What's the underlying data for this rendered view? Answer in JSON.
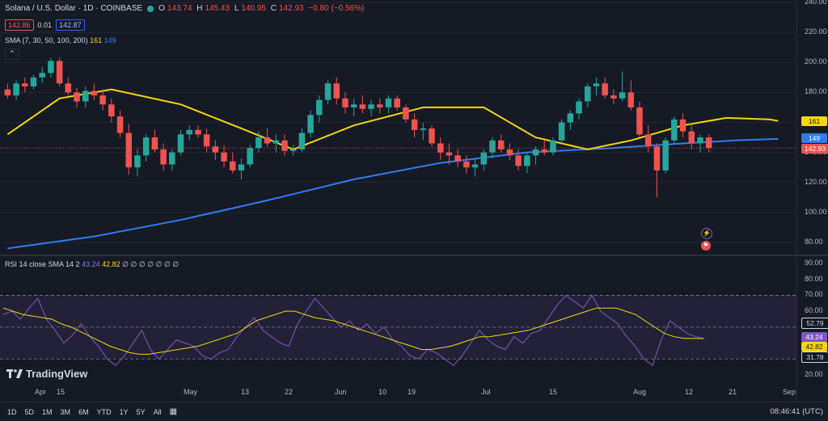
{
  "header": {
    "symbol": "Solana / U.S. Dollar · 1D · COINBASE",
    "ohlc": {
      "o_label": "O",
      "o": "143.74",
      "h_label": "H",
      "h": "145.43",
      "l_label": "L",
      "l": "140.95",
      "c_label": "C",
      "c": "142.93",
      "chg": "−0.80 (−0.56%)"
    },
    "bid": "142.86",
    "spread": "0.01",
    "ask": "142.87"
  },
  "indicators": {
    "sma_label": "SMA (7, 30, 50, 100, 200)",
    "sma_v1": "161",
    "sma_v2": "149",
    "rsi_label": "RSI 14 close SMA 14 2",
    "rsi_v": "43.24",
    "rsi_sma": "42.82",
    "rsi_tail": "∅ ∅ ∅ ∅ ∅ ∅ ∅"
  },
  "price_axis": [
    "240.00",
    "220.00",
    "200.00",
    "180.00",
    "160.00",
    "140.00",
    "120.00",
    "100.00",
    "80.00"
  ],
  "price_labels": {
    "sma_yellow": "161",
    "sma_blue": "149",
    "last": "142.93"
  },
  "rsi_axis": [
    "90.00",
    "80.00",
    "70.00",
    "60.00",
    "50.00",
    "40.00",
    "30.00",
    "20.00"
  ],
  "rsi_labels": {
    "a": "52.79",
    "b": "43.24",
    "c": "42.82",
    "d": "31.78"
  },
  "time_axis": [
    "Apr",
    "15",
    "May",
    "13",
    "22",
    "Jun",
    "10",
    "19",
    "Jul",
    "15",
    "Aug",
    "12",
    "21",
    "Sep"
  ],
  "timeframes": [
    "1D",
    "5D",
    "1M",
    "3M",
    "6M",
    "YTD",
    "1Y",
    "5Y",
    "All"
  ],
  "clock": "08:46:41 (UTC)",
  "logo": "TradingView",
  "colors": {
    "up": "#26a69a",
    "down": "#ef5350",
    "sma_yellow": "#f5d60b",
    "sma_blue": "#2d7cf2",
    "rsi": "#7e57c2",
    "bg": "#161a25"
  },
  "chart_data": {
    "type": "candlestick",
    "ylim": [
      70,
      240
    ],
    "rsi_ylim": [
      20,
      90
    ],
    "rsi_bands": [
      30,
      70
    ],
    "candles": [
      [
        182,
        186,
        176,
        178
      ],
      [
        178,
        188,
        175,
        186
      ],
      [
        186,
        190,
        180,
        184
      ],
      [
        184,
        192,
        182,
        190
      ],
      [
        190,
        197,
        186,
        193
      ],
      [
        193,
        203,
        190,
        201
      ],
      [
        201,
        203,
        184,
        186
      ],
      [
        186,
        190,
        178,
        180
      ],
      [
        180,
        183,
        170,
        174
      ],
      [
        174,
        184,
        170,
        181
      ],
      [
        181,
        186,
        175,
        178
      ],
      [
        178,
        182,
        168,
        172
      ],
      [
        172,
        176,
        160,
        164
      ],
      [
        164,
        168,
        150,
        153
      ],
      [
        153,
        159,
        125,
        130
      ],
      [
        130,
        142,
        124,
        138
      ],
      [
        138,
        152,
        134,
        150
      ],
      [
        150,
        155,
        140,
        142
      ],
      [
        142,
        146,
        128,
        132
      ],
      [
        132,
        142,
        128,
        140
      ],
      [
        140,
        155,
        138,
        152
      ],
      [
        152,
        158,
        148,
        155
      ],
      [
        155,
        158,
        150,
        152
      ],
      [
        152,
        156,
        140,
        144
      ],
      [
        144,
        148,
        135,
        140
      ],
      [
        140,
        145,
        130,
        134
      ],
      [
        134,
        140,
        126,
        128
      ],
      [
        128,
        136,
        122,
        132
      ],
      [
        132,
        145,
        130,
        143
      ],
      [
        143,
        154,
        140,
        150
      ],
      [
        150,
        156,
        144,
        146
      ],
      [
        146,
        152,
        140,
        148
      ],
      [
        148,
        152,
        138,
        141
      ],
      [
        141,
        145,
        138,
        142
      ],
      [
        142,
        156,
        140,
        153
      ],
      [
        153,
        168,
        150,
        165
      ],
      [
        165,
        178,
        160,
        175
      ],
      [
        175,
        188,
        172,
        186
      ],
      [
        186,
        190,
        172,
        176
      ],
      [
        176,
        180,
        166,
        170
      ],
      [
        170,
        176,
        164,
        172
      ],
      [
        172,
        178,
        166,
        169
      ],
      [
        169,
        175,
        164,
        172
      ],
      [
        172,
        176,
        166,
        170
      ],
      [
        170,
        178,
        166,
        176
      ],
      [
        176,
        178,
        168,
        170
      ],
      [
        170,
        172,
        160,
        162
      ],
      [
        162,
        166,
        150,
        155
      ],
      [
        155,
        160,
        148,
        156
      ],
      [
        156,
        158,
        144,
        146
      ],
      [
        146,
        150,
        135,
        140
      ],
      [
        140,
        146,
        132,
        138
      ],
      [
        138,
        142,
        130,
        134
      ],
      [
        134,
        138,
        126,
        130
      ],
      [
        130,
        136,
        124,
        132
      ],
      [
        132,
        142,
        128,
        140
      ],
      [
        140,
        150,
        136,
        148
      ],
      [
        148,
        152,
        140,
        142
      ],
      [
        142,
        146,
        135,
        138
      ],
      [
        138,
        142,
        128,
        131
      ],
      [
        131,
        140,
        126,
        138
      ],
      [
        138,
        144,
        132,
        142
      ],
      [
        142,
        148,
        138,
        140
      ],
      [
        140,
        150,
        138,
        148
      ],
      [
        148,
        162,
        146,
        160
      ],
      [
        160,
        168,
        155,
        166
      ],
      [
        166,
        176,
        162,
        174
      ],
      [
        174,
        186,
        170,
        184
      ],
      [
        184,
        190,
        178,
        186
      ],
      [
        186,
        190,
        176,
        178
      ],
      [
        178,
        182,
        172,
        176
      ],
      [
        176,
        194,
        174,
        180
      ],
      [
        180,
        188,
        168,
        170
      ],
      [
        170,
        174,
        150,
        152
      ],
      [
        152,
        158,
        140,
        144
      ],
      [
        144,
        146,
        110,
        128
      ],
      [
        128,
        150,
        126,
        148
      ],
      [
        148,
        164,
        146,
        162
      ],
      [
        162,
        166,
        150,
        154
      ],
      [
        154,
        158,
        142,
        146
      ],
      [
        146,
        152,
        140,
        150
      ],
      [
        150,
        152,
        140,
        143
      ]
    ],
    "sma_yellow": [
      [
        0,
        152
      ],
      [
        6,
        176
      ],
      [
        12,
        182
      ],
      [
        20,
        172
      ],
      [
        27,
        156
      ],
      [
        33,
        142
      ],
      [
        40,
        158
      ],
      [
        48,
        170
      ],
      [
        55,
        170
      ],
      [
        61,
        150
      ],
      [
        67,
        142
      ],
      [
        72,
        148
      ],
      [
        78,
        158
      ],
      [
        83,
        163
      ],
      [
        88,
        162
      ],
      [
        89,
        161
      ]
    ],
    "sma_blue": [
      [
        0,
        76
      ],
      [
        10,
        84
      ],
      [
        20,
        95
      ],
      [
        30,
        108
      ],
      [
        40,
        122
      ],
      [
        50,
        133
      ],
      [
        60,
        140
      ],
      [
        70,
        143
      ],
      [
        78,
        146
      ],
      [
        84,
        148
      ],
      [
        89,
        149
      ]
    ],
    "rsi": [
      58,
      60,
      55,
      62,
      68,
      55,
      48,
      40,
      45,
      52,
      44,
      38,
      30,
      26,
      32,
      40,
      48,
      36,
      30,
      36,
      42,
      40,
      38,
      32,
      30,
      34,
      36,
      44,
      50,
      56,
      48,
      44,
      40,
      38,
      52,
      60,
      68,
      62,
      56,
      50,
      54,
      48,
      52,
      46,
      50,
      42,
      38,
      32,
      30,
      36,
      34,
      30,
      26,
      32,
      40,
      48,
      42,
      38,
      36,
      44,
      40,
      46,
      48,
      56,
      64,
      70,
      66,
      62,
      70,
      60,
      56,
      52,
      44,
      38,
      30,
      26,
      42,
      54,
      50,
      46,
      44,
      43
    ],
    "rsi_sma": [
      62,
      60,
      58,
      57,
      56,
      55,
      52,
      50,
      47,
      44,
      41,
      38,
      36,
      34,
      33,
      33,
      34,
      35,
      36,
      37,
      38,
      40,
      42,
      44,
      46,
      50,
      54,
      56,
      58,
      60,
      60,
      58,
      56,
      55,
      54,
      52,
      50,
      48,
      46,
      44,
      42,
      40,
      38,
      36,
      36,
      37,
      38,
      40,
      42,
      44,
      44,
      45,
      46,
      47,
      48,
      50,
      52,
      54,
      56,
      58,
      60,
      62,
      62,
      62,
      60,
      58,
      54,
      50,
      46,
      44,
      43,
      43,
      42.8
    ]
  }
}
